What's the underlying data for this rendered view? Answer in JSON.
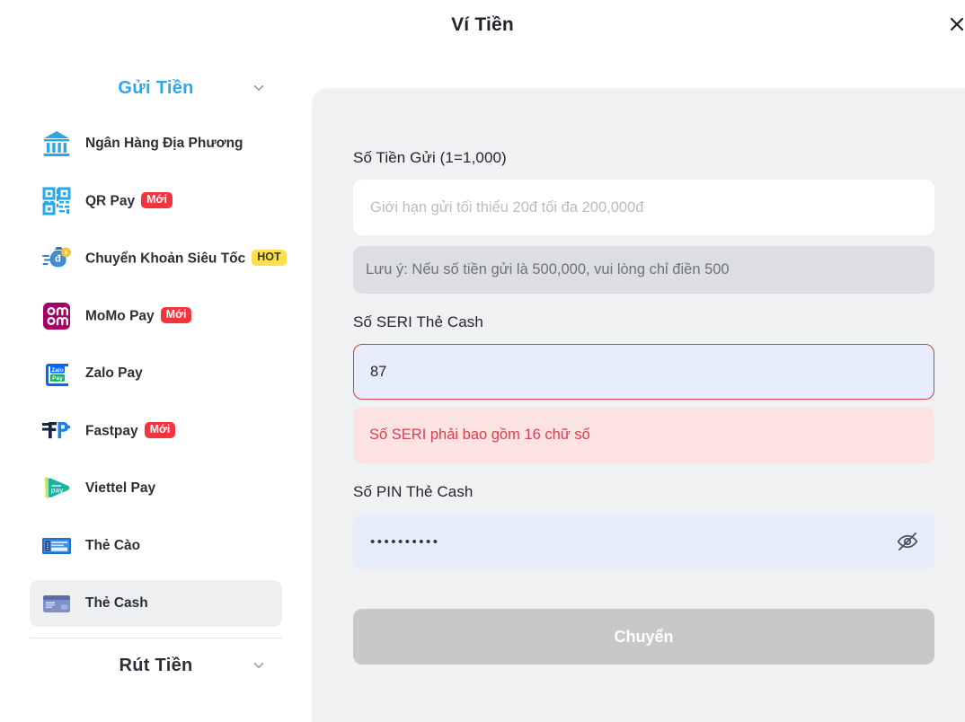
{
  "header": {
    "title": "Ví Tiền",
    "close_icon": "close-icon"
  },
  "sidebar": {
    "deposit_section": {
      "title": "Gửi Tiền",
      "chevron_icon": "chevron-down-icon",
      "expanded": true
    },
    "withdraw_section": {
      "title": "Rút Tiền",
      "chevron_icon": "chevron-down-icon",
      "expanded": false
    },
    "items": [
      {
        "label": "Ngân Hàng Địa Phương",
        "icon": "bank-icon",
        "badge": "",
        "selected": false
      },
      {
        "label": "QR Pay",
        "icon": "qr-code-icon",
        "badge": "Mới",
        "badge_type": "new",
        "selected": false
      },
      {
        "label": "Chuyển Khoản Siêu Tốc",
        "icon": "money-bag-fast-icon",
        "badge": "HOT",
        "badge_type": "hot",
        "selected": false
      },
      {
        "label": "MoMo Pay",
        "icon": "momo-logo-icon",
        "badge": "Mới",
        "badge_type": "new",
        "selected": false
      },
      {
        "label": "Zalo Pay",
        "icon": "zalopay-logo-icon",
        "badge": "",
        "selected": false
      },
      {
        "label": "Fastpay",
        "icon": "fastpay-logo-icon",
        "badge": "Mới",
        "badge_type": "new",
        "selected": false
      },
      {
        "label": "Viettel Pay",
        "icon": "viettelpay-logo-icon",
        "badge": "",
        "selected": false
      },
      {
        "label": "Thẻ Cào",
        "icon": "scratch-card-icon",
        "badge": "",
        "selected": false
      },
      {
        "label": "Thẻ Cash",
        "icon": "credit-card-icon",
        "badge": "",
        "selected": true
      }
    ]
  },
  "form": {
    "amount": {
      "label": "Số Tiền Gửi (1=1,000)",
      "placeholder": "Giới hạn gửi tối thiểu 20đ tối đa 200,000đ",
      "value": ""
    },
    "note": "Lưu ý: Nếu số tiền gửi là 500,000, vui lòng chỉ điền 500",
    "seri": {
      "label": "Số SERI Thẻ Cash",
      "value": "87",
      "error": "Số SERI phải bao gồm 16 chữ số"
    },
    "pin": {
      "label": "Số PIN Thẻ Cash",
      "masked_value": "••••••••••",
      "toggle_icon": "eye-off-icon"
    },
    "submit_label": "Chuyển"
  },
  "colors": {
    "accent_blue": "#2aa8f0",
    "badge_new": "#f5333f",
    "badge_hot": "#fcde4e",
    "error_red": "#d6404f",
    "panel_bg": "#f0f1f3",
    "submit_disabled": "#c7c8ca"
  }
}
